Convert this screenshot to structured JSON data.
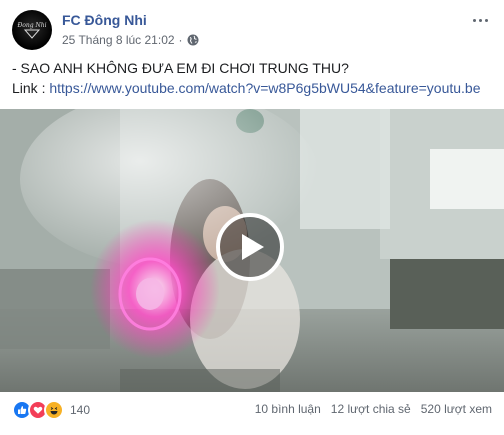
{
  "header": {
    "avatar_text": "Đong Nhi",
    "page_name": "FC Đông Nhi",
    "timestamp": "25 Tháng 8 lúc 21:02",
    "separator": "·",
    "privacy_icon": "globe-icon",
    "more_icon": "more-horizontal-icon"
  },
  "post": {
    "line1": "- SAO ANH KHÔNG ĐƯA EM ĐI CHƠI TRUNG THU?",
    "link_prefix": "Link : ",
    "link_url": "https://www.youtube.com/watch?v=w8P6g5bWU54&feature=youtu.be"
  },
  "video": {
    "play_icon": "play-icon"
  },
  "footer": {
    "reactions": [
      "like",
      "love",
      "haha"
    ],
    "reaction_count": "140",
    "comments": "10 bình luận",
    "shares": "12 lượt chia sẻ",
    "views": "520 lượt xem"
  },
  "colors": {
    "link": "#385898",
    "text": "#1c1e21",
    "meta": "#616770",
    "like": "#1877f2",
    "love": "#f33e58",
    "haha": "#f7b125"
  }
}
